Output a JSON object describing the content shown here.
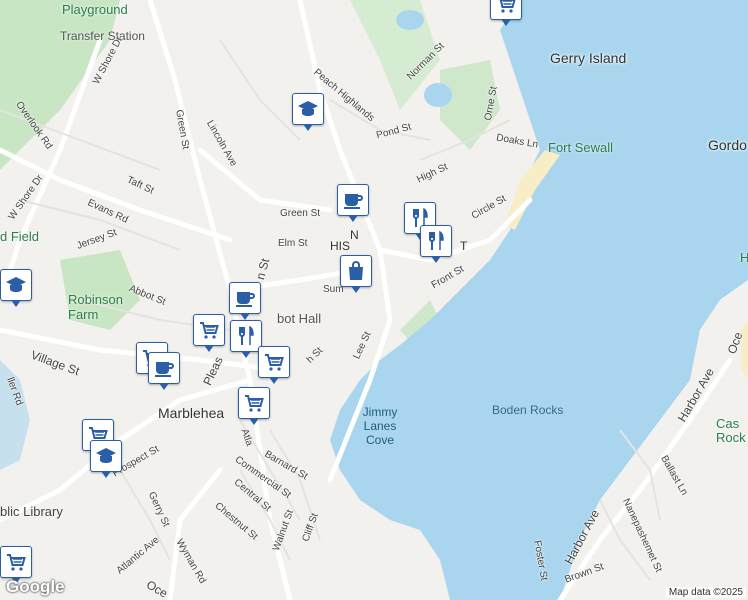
{
  "map": {
    "attribution": "Map data ©2025",
    "logo": "Google"
  },
  "labels": {
    "playground": "Playground",
    "transfer_station": "Transfer Station",
    "gerry_island": "Gerry Island",
    "fort_sewall": "Fort Sewall",
    "gordo": "Gordo",
    "field": "d Field",
    "robinson_farm": "Robinson Farm",
    "abbot_hall": "bot Hall",
    "historic": "HIS",
    "historic_t": "T",
    "marblehead": "Marblehea",
    "jimmy_lanes_cove": "Jimmy Lanes Cove",
    "boden_rocks": "Boden Rocks",
    "castle_rock": "Cas Rock",
    "public_library": "blic Library",
    "h_edge": "H",
    "n_letter": "N"
  },
  "streets": {
    "w_shore_dr_top": "W Shore Dr",
    "w_shore_dr_mid": "W Shore Dr",
    "green_st_v": "Green St",
    "lincoln_ave": "Lincoln Ave",
    "overlook_rd": "Overlook Rd",
    "taft_st": "Taft St",
    "evans_rd": "Evans Rd",
    "jersey_st": "Jersey St",
    "abbot_st": "Abbot St",
    "green_st": "Green St",
    "elm_st": "Elm St",
    "peach_highlands": "Peach Highlands",
    "pond_st": "Pond St",
    "norman_st": "Norman St",
    "high_st": "High St",
    "orne_st": "Orne St",
    "doaks_ln": "Doaks Ln",
    "circle_st": "Circle St",
    "front_st": "Front St",
    "lee_st": "Lee St",
    "summer": "Sum",
    "village_st": "Village St",
    "pleasant_st": "Pleas",
    "washington_st": "n St",
    "union_st": "h St",
    "atlantic": "Atla",
    "barnard_st": "Barnard St",
    "commercial_st": "Commercial St",
    "central_st": "Central St",
    "chestnut_st": "Chestnut St",
    "walnut_st": "Walnut St",
    "cliff_st": "Cliff St",
    "prospect_st": "Prospect St",
    "gerry_st": "Gerry St",
    "atlantic_ave": "Atlantic Ave",
    "wyman_rd": "Wyman Rd",
    "ocean_bottom": "Oce",
    "miller_rd": "ller Rd",
    "harbor_ave_right": "Harbor Ave",
    "harbor_ave_bottom": "Harbor Ave",
    "ballast_ln": "Ballast Ln",
    "nanepashemet_st": "Nanepashemet St",
    "foster_st": "Foster St",
    "brown_st": "Brown St",
    "ocean_right": "Oce",
    "norman": "Norman St"
  },
  "colors": {
    "water": "#a9d6ee",
    "land": "#f2f1ee",
    "park": "#c8e6c4",
    "road": "#ffffff",
    "pin_border": "#2a5fa8"
  },
  "pins": [
    {
      "icon": "cart-icon"
    },
    {
      "icon": "school-icon"
    },
    {
      "icon": "coffee-icon"
    },
    {
      "icon": "restaurant-icon"
    },
    {
      "icon": "restaurant-icon"
    },
    {
      "icon": "shopping-bag-icon"
    },
    {
      "icon": "coffee-icon"
    },
    {
      "icon": "cart-icon"
    },
    {
      "icon": "restaurant-icon"
    },
    {
      "icon": "cart-icon"
    },
    {
      "icon": "cart-icon"
    },
    {
      "icon": "coffee-icon"
    },
    {
      "icon": "cart-icon"
    },
    {
      "icon": "cart-icon"
    },
    {
      "icon": "school-icon"
    },
    {
      "icon": "school-icon"
    },
    {
      "icon": "cart-icon"
    }
  ]
}
